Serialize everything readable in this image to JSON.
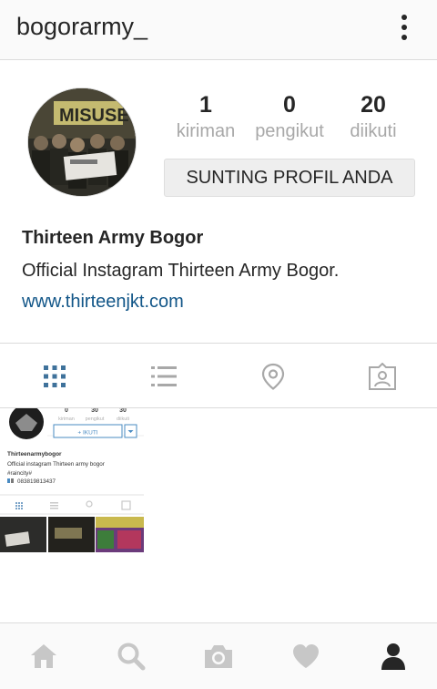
{
  "header": {
    "username": "bogorarmy_",
    "menu_icon": "more-vertical-icon"
  },
  "profile": {
    "avatar_icon": "profile-photo-group",
    "stats": [
      {
        "value": "1",
        "label": "kiriman"
      },
      {
        "value": "0",
        "label": "pengikut"
      },
      {
        "value": "20",
        "label": "diikuti"
      }
    ],
    "edit_button_label": "SUNTING PROFIL ANDA",
    "full_name": "Thirteen Army Bogor",
    "bio": "Official Instagram Thirteen Army Bogor.",
    "website": "www.thirteenjkt.com"
  },
  "tabs": [
    {
      "icon": "grid-view-icon",
      "active": true
    },
    {
      "icon": "list-view-icon",
      "active": false
    },
    {
      "icon": "location-pin-icon",
      "active": false
    },
    {
      "icon": "tagged-photos-icon",
      "active": false
    }
  ],
  "post_thumbnail": {
    "stats": [
      {
        "value": "0",
        "label": "kiriman"
      },
      {
        "value": "30",
        "label": "pengikut"
      },
      {
        "value": "30",
        "label": "diikuti"
      }
    ],
    "follow_label": "+ IKUTI",
    "name": "Thirteenarmybogor",
    "bio_line1": "Official instagram Thirteen army bogor",
    "bio_line2": "#raincity#",
    "bio_line3": "083819813437"
  },
  "bottom_nav": [
    {
      "icon": "home-icon",
      "active": false
    },
    {
      "icon": "search-icon",
      "active": false
    },
    {
      "icon": "camera-icon",
      "active": false
    },
    {
      "icon": "heart-icon",
      "active": false
    },
    {
      "icon": "profile-icon",
      "active": true
    }
  ],
  "colors": {
    "active_tab": "#3f729b",
    "inactive_icon": "#a8a8a8",
    "link": "#125688",
    "text": "#262626"
  }
}
